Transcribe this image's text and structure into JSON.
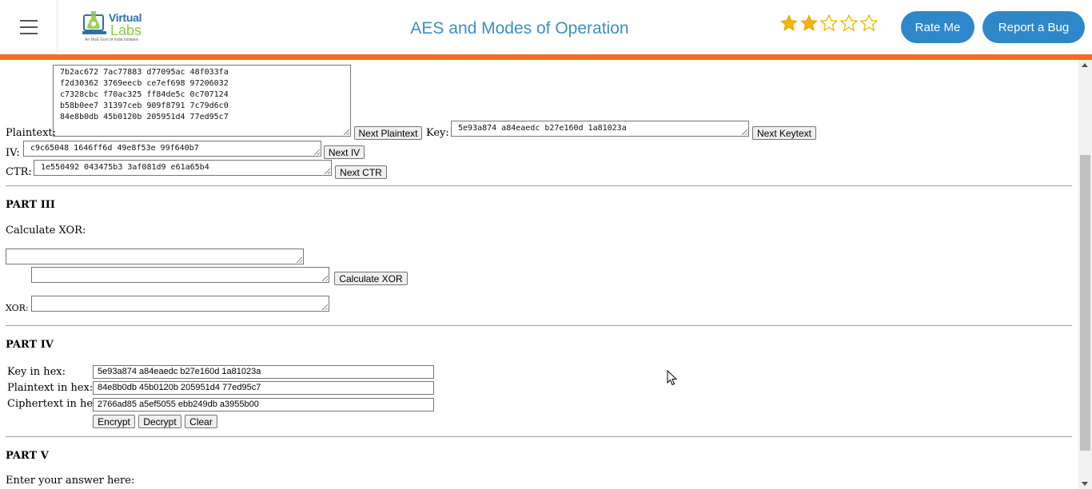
{
  "header": {
    "title": "AES and Modes of Operation",
    "logo_word1": "Virtual",
    "logo_word2": "Labs",
    "logo_tagline": "An MoE Govt of India Initiative",
    "rating": 2,
    "max_rating": 5,
    "rate_label": "Rate Me",
    "bug_label": "Report a Bug",
    "accent_color": "#2e87c9",
    "bar_color": "#f26f21"
  },
  "part2": {
    "plaintext_label": "Plaintext:",
    "plaintext_lines": "7b2ac672 7ac77883 d77095ac 48f033fa\nf2d30362 3769eecb ce7ef698 97206032\nc7328cbc f70ac325 ff84de5c 0c707124\nb58b0ee7 31397ceb 909f8791 7c79d6c0\n84e8b0db 45b0120b 205951d4 77ed95c7",
    "next_plaintext": "Next Plaintext",
    "key_label": "Key:",
    "key_value": "5e93a874 a84eaedc b27e160d 1a81023a",
    "next_keytext": "Next Keytext",
    "iv_label": "IV:",
    "iv_value": "c9c65048 1646ff6d 49e8f53e 99f640b7",
    "next_iv": "Next IV",
    "ctr_label": "CTR:",
    "ctr_value": "1e550492 043475b3 3af081d9 e61a65b4",
    "next_ctr": "Next CTR"
  },
  "part3": {
    "heading": "PART III",
    "calc_label": "Calculate XOR:",
    "input1": "",
    "input2": "",
    "calc_button": "Calculate XOR",
    "xor_label": "XOR:",
    "xor_value": ""
  },
  "part4": {
    "heading": "PART IV",
    "key_label": "Key in hex:",
    "key_value": "5e93a874 a84eaedc b27e160d 1a81023a",
    "plaintext_label": "Plaintext in hex:",
    "plaintext_value": "84e8b0db 45b0120b 205951d4 77ed95c7",
    "ciphertext_label": "Ciphertext in hex:",
    "ciphertext_value": "2766ad85 a5ef5055 ebb249db a3955b00",
    "encrypt": "Encrypt",
    "decrypt": "Decrypt",
    "clear": "Clear"
  },
  "part5": {
    "heading": "PART V",
    "answer_label": "Enter your answer here:"
  }
}
